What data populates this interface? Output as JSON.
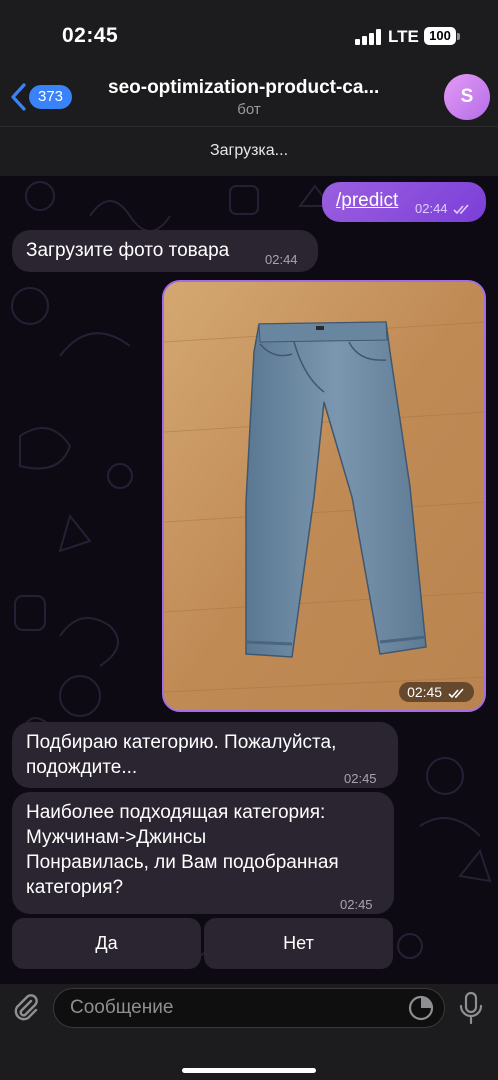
{
  "status_bar": {
    "time": "02:45",
    "network": "LTE",
    "battery": "100"
  },
  "header": {
    "unread_count": "373",
    "title": "seo-optimization-product-ca...",
    "subtitle": "бот",
    "avatar_letter": "S",
    "loading_text": "Загрузка..."
  },
  "messages": [
    {
      "direction": "out",
      "text": "/predict",
      "time": "02:44"
    },
    {
      "direction": "in",
      "text": "Загрузите фото товара",
      "time": "02:44"
    },
    {
      "direction": "out",
      "type": "photo",
      "photo_subject": "jeans-photo",
      "time": "02:45"
    },
    {
      "direction": "in",
      "lines": [
        "Подбираю категорию. Пожалуйста,",
        "подождите..."
      ],
      "time": "02:45"
    },
    {
      "direction": "in",
      "lines": [
        "Наиболее подходящая категория:",
        "Мужчинам->Джинсы",
        "Понравилась, ли Вам подобранная",
        "категория?"
      ],
      "time": "02:45"
    }
  ],
  "keyboard_buttons": [
    "Да",
    "Нет"
  ],
  "input": {
    "placeholder": "Сообщение"
  },
  "icons": {
    "back": "chevron-left-icon",
    "attach": "paperclip-icon",
    "sticker": "sticker-icon",
    "mic": "microphone-icon"
  },
  "colors": {
    "outgoing_bubble": "#8a4fdc",
    "incoming_bubble": "#2a2530",
    "accent": "#3a82f7",
    "header_bg": "#1c1c1e"
  }
}
